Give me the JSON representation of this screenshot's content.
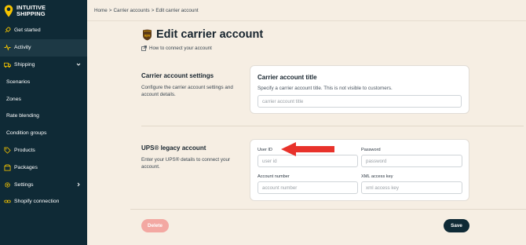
{
  "brand": {
    "line1": "INTUITIVE",
    "line2": "SHIPPING"
  },
  "sidebar": {
    "items": [
      {
        "label": "Get started",
        "icon": "rocket-icon"
      },
      {
        "label": "Activity",
        "icon": "pulse-icon"
      },
      {
        "label": "Shipping",
        "icon": "truck-icon",
        "chevron": "chevron-down"
      },
      {
        "label": "Scenarios"
      },
      {
        "label": "Zones"
      },
      {
        "label": "Rate blending"
      },
      {
        "label": "Condition groups"
      },
      {
        "label": "Products",
        "icon": "tag-icon"
      },
      {
        "label": "Packages",
        "icon": "box-icon"
      },
      {
        "label": "Settings",
        "icon": "gear-icon",
        "chevron": "chevron-right"
      },
      {
        "label": "Shopify connection",
        "icon": "link-icon"
      }
    ]
  },
  "breadcrumb": {
    "home": "Home",
    "sep": ">",
    "carrier_accounts": "Carrier accounts",
    "current": "Edit carrier account"
  },
  "page": {
    "title": "Edit carrier account",
    "help_link": "How to connect your account"
  },
  "settings_section": {
    "title": "Carrier account settings",
    "description": "Configure the carrier account settings and account details.",
    "card_title": "Carrier account title",
    "card_sub": "Specify a carrier account title. This is not visible to customers.",
    "input_placeholder": "carrier account title"
  },
  "ups_section": {
    "title": "UPS® legacy account",
    "description": "Enter your UPS® details to connect your account.",
    "fields": {
      "user_id": {
        "label": "User ID",
        "placeholder": "user id"
      },
      "password": {
        "label": "Password",
        "placeholder": "password"
      },
      "account_number": {
        "label": "Account number",
        "placeholder": "account number"
      },
      "xml_key": {
        "label": "XML access key",
        "placeholder": "xml access key"
      }
    }
  },
  "actions": {
    "delete": "Delete",
    "save": "Save"
  },
  "colors": {
    "sidebar_bg": "#0f2a36",
    "page_bg": "#f6eee3",
    "delete_bg": "#f3a8a2",
    "arrow": "#e8322b",
    "brand_pin": "#f5c400",
    "ups_brown": "#5b3a18"
  }
}
